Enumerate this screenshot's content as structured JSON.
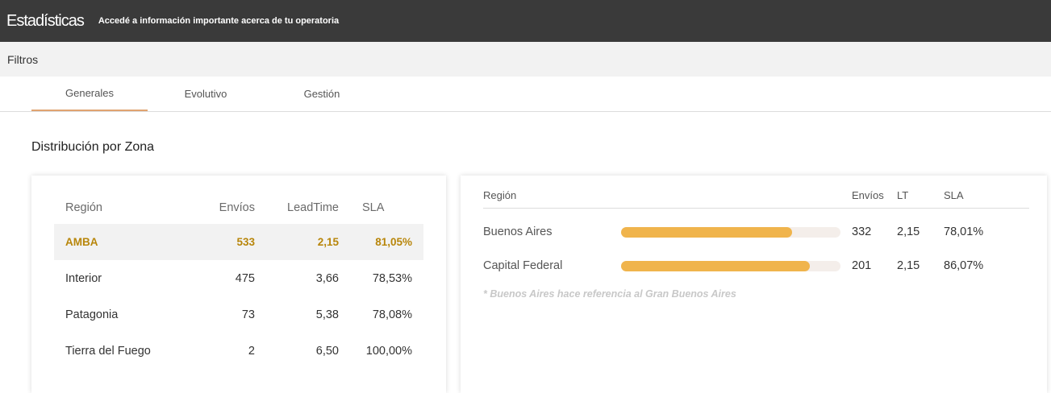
{
  "header": {
    "title": "Estadísticas",
    "subtitle": "Accedé a información importante acerca de tu operatoria"
  },
  "filters": {
    "label": "Filtros"
  },
  "tabs": [
    {
      "label": "Generales",
      "active": true
    },
    {
      "label": "Evolutivo",
      "active": false
    },
    {
      "label": "Gestión",
      "active": false
    }
  ],
  "section": {
    "title": "Distribución por Zona"
  },
  "zone_table": {
    "headers": {
      "region": "Región",
      "envios": "Envíos",
      "leadtime": "LeadTime",
      "sla": "SLA"
    },
    "rows": [
      {
        "region": "AMBA",
        "envios": "533",
        "leadtime": "2,15",
        "sla": "81,05%",
        "highlighted": true
      },
      {
        "region": "Interior",
        "envios": "475",
        "leadtime": "3,66",
        "sla": "78,53%"
      },
      {
        "region": "Patagonia",
        "envios": "73",
        "leadtime": "5,38",
        "sla": "78,08%"
      },
      {
        "region": "Tierra del Fuego",
        "envios": "2",
        "leadtime": "6,50",
        "sla": "100,00%"
      }
    ]
  },
  "amba_table": {
    "headers": {
      "region": "Región",
      "envios": "Envíos",
      "lt": "LT",
      "sla": "SLA"
    },
    "rows": [
      {
        "region": "Buenos Aires",
        "bar_fraction": 0.78,
        "envios": "332",
        "lt": "2,15",
        "sla": "78,01%"
      },
      {
        "region": "Capital Federal",
        "bar_fraction": 0.86,
        "envios": "201",
        "lt": "2,15",
        "sla": "86,07%"
      }
    ],
    "note": "* Buenos Aires hace referencia al Gran Buenos Aires"
  },
  "colors": {
    "header_bg": "#3a3a3a",
    "accent": "#e0a370",
    "highlight_text": "#b8860b",
    "bar": "#f0b44c"
  }
}
